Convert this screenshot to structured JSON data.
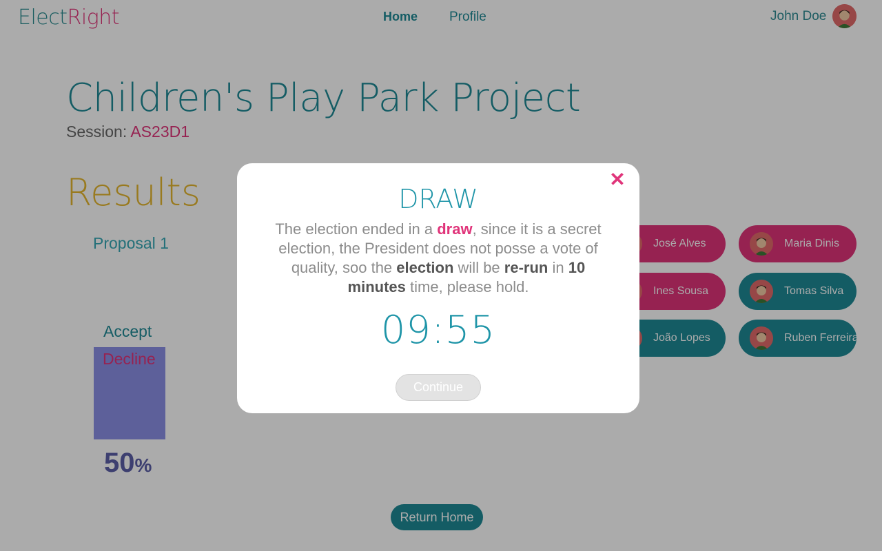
{
  "header": {
    "logo_part1": "Elect",
    "logo_part2": "Right",
    "nav_home": "Home",
    "nav_profile": "Profile",
    "user_name": "John Doe"
  },
  "project": {
    "title": "Children's Play Park Project",
    "session_label": "Session: ",
    "session_code": "AS23D1"
  },
  "results": {
    "title": "Results",
    "proposal_label": "Proposal 1",
    "accept_label": "Accept",
    "decline_label": "Decline",
    "percent_value": "50",
    "percent_symbol": "%"
  },
  "candidates": [
    {
      "name": "José Alves",
      "color": "pink"
    },
    {
      "name": "Maria Dinis",
      "color": "pink"
    },
    {
      "name": "Ines Sousa",
      "color": "pink"
    },
    {
      "name": "Tomas Silva",
      "color": "teal"
    },
    {
      "name": "João Lopes",
      "color": "teal"
    },
    {
      "name": "Ruben Ferreira",
      "color": "teal"
    }
  ],
  "actions": {
    "return_home": "Return Home"
  },
  "modal": {
    "title": "DRAW",
    "msg_1": "The election ended in a ",
    "msg_draw": "draw",
    "msg_2": ", since it is a secret election, the President does not posse a vote of quality, soo the ",
    "msg_election": "election",
    "msg_3": " will be ",
    "msg_rerun": "re-run",
    "msg_4": " in ",
    "msg_minutes": "10 minutes",
    "msg_5": " time, please hold.",
    "timer": "09:55",
    "continue_label": "Continue",
    "close_glyph": "✕"
  },
  "colors": {
    "teal": "#1f8a96",
    "pink": "#e0347a",
    "gold": "#e4b72f",
    "bar": "#8b8fe6"
  }
}
